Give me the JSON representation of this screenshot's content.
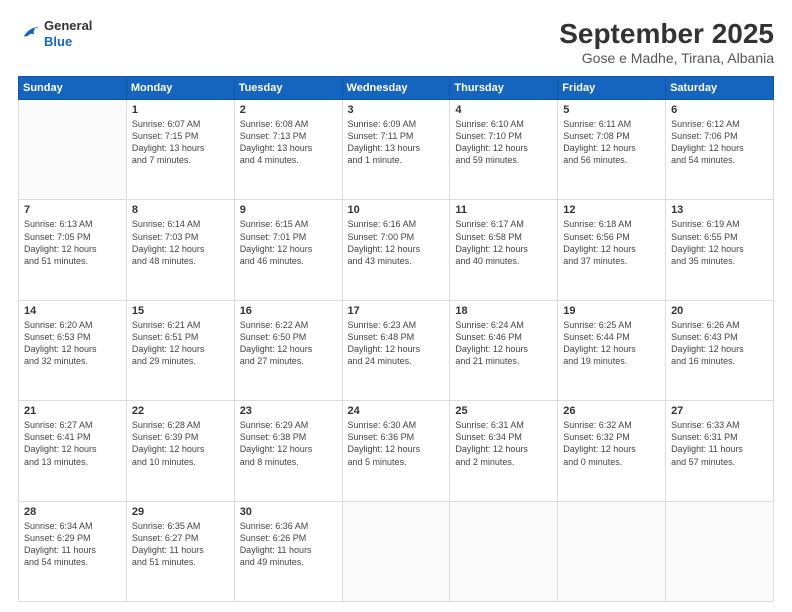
{
  "header": {
    "logo_general": "General",
    "logo_blue": "Blue",
    "title": "September 2025",
    "subtitle": "Gose e Madhe, Tirana, Albania"
  },
  "calendar": {
    "days_of_week": [
      "Sunday",
      "Monday",
      "Tuesday",
      "Wednesday",
      "Thursday",
      "Friday",
      "Saturday"
    ],
    "weeks": [
      [
        {
          "day": "",
          "info": ""
        },
        {
          "day": "1",
          "info": "Sunrise: 6:07 AM\nSunset: 7:15 PM\nDaylight: 13 hours\nand 7 minutes."
        },
        {
          "day": "2",
          "info": "Sunrise: 6:08 AM\nSunset: 7:13 PM\nDaylight: 13 hours\nand 4 minutes."
        },
        {
          "day": "3",
          "info": "Sunrise: 6:09 AM\nSunset: 7:11 PM\nDaylight: 13 hours\nand 1 minute."
        },
        {
          "day": "4",
          "info": "Sunrise: 6:10 AM\nSunset: 7:10 PM\nDaylight: 12 hours\nand 59 minutes."
        },
        {
          "day": "5",
          "info": "Sunrise: 6:11 AM\nSunset: 7:08 PM\nDaylight: 12 hours\nand 56 minutes."
        },
        {
          "day": "6",
          "info": "Sunrise: 6:12 AM\nSunset: 7:06 PM\nDaylight: 12 hours\nand 54 minutes."
        }
      ],
      [
        {
          "day": "7",
          "info": "Sunrise: 6:13 AM\nSunset: 7:05 PM\nDaylight: 12 hours\nand 51 minutes."
        },
        {
          "day": "8",
          "info": "Sunrise: 6:14 AM\nSunset: 7:03 PM\nDaylight: 12 hours\nand 48 minutes."
        },
        {
          "day": "9",
          "info": "Sunrise: 6:15 AM\nSunset: 7:01 PM\nDaylight: 12 hours\nand 46 minutes."
        },
        {
          "day": "10",
          "info": "Sunrise: 6:16 AM\nSunset: 7:00 PM\nDaylight: 12 hours\nand 43 minutes."
        },
        {
          "day": "11",
          "info": "Sunrise: 6:17 AM\nSunset: 6:58 PM\nDaylight: 12 hours\nand 40 minutes."
        },
        {
          "day": "12",
          "info": "Sunrise: 6:18 AM\nSunset: 6:56 PM\nDaylight: 12 hours\nand 37 minutes."
        },
        {
          "day": "13",
          "info": "Sunrise: 6:19 AM\nSunset: 6:55 PM\nDaylight: 12 hours\nand 35 minutes."
        }
      ],
      [
        {
          "day": "14",
          "info": "Sunrise: 6:20 AM\nSunset: 6:53 PM\nDaylight: 12 hours\nand 32 minutes."
        },
        {
          "day": "15",
          "info": "Sunrise: 6:21 AM\nSunset: 6:51 PM\nDaylight: 12 hours\nand 29 minutes."
        },
        {
          "day": "16",
          "info": "Sunrise: 6:22 AM\nSunset: 6:50 PM\nDaylight: 12 hours\nand 27 minutes."
        },
        {
          "day": "17",
          "info": "Sunrise: 6:23 AM\nSunset: 6:48 PM\nDaylight: 12 hours\nand 24 minutes."
        },
        {
          "day": "18",
          "info": "Sunrise: 6:24 AM\nSunset: 6:46 PM\nDaylight: 12 hours\nand 21 minutes."
        },
        {
          "day": "19",
          "info": "Sunrise: 6:25 AM\nSunset: 6:44 PM\nDaylight: 12 hours\nand 19 minutes."
        },
        {
          "day": "20",
          "info": "Sunrise: 6:26 AM\nSunset: 6:43 PM\nDaylight: 12 hours\nand 16 minutes."
        }
      ],
      [
        {
          "day": "21",
          "info": "Sunrise: 6:27 AM\nSunset: 6:41 PM\nDaylight: 12 hours\nand 13 minutes."
        },
        {
          "day": "22",
          "info": "Sunrise: 6:28 AM\nSunset: 6:39 PM\nDaylight: 12 hours\nand 10 minutes."
        },
        {
          "day": "23",
          "info": "Sunrise: 6:29 AM\nSunset: 6:38 PM\nDaylight: 12 hours\nand 8 minutes."
        },
        {
          "day": "24",
          "info": "Sunrise: 6:30 AM\nSunset: 6:36 PM\nDaylight: 12 hours\nand 5 minutes."
        },
        {
          "day": "25",
          "info": "Sunrise: 6:31 AM\nSunset: 6:34 PM\nDaylight: 12 hours\nand 2 minutes."
        },
        {
          "day": "26",
          "info": "Sunrise: 6:32 AM\nSunset: 6:32 PM\nDaylight: 12 hours\nand 0 minutes."
        },
        {
          "day": "27",
          "info": "Sunrise: 6:33 AM\nSunset: 6:31 PM\nDaylight: 11 hours\nand 57 minutes."
        }
      ],
      [
        {
          "day": "28",
          "info": "Sunrise: 6:34 AM\nSunset: 6:29 PM\nDaylight: 11 hours\nand 54 minutes."
        },
        {
          "day": "29",
          "info": "Sunrise: 6:35 AM\nSunset: 6:27 PM\nDaylight: 11 hours\nand 51 minutes."
        },
        {
          "day": "30",
          "info": "Sunrise: 6:36 AM\nSunset: 6:26 PM\nDaylight: 11 hours\nand 49 minutes."
        },
        {
          "day": "",
          "info": ""
        },
        {
          "day": "",
          "info": ""
        },
        {
          "day": "",
          "info": ""
        },
        {
          "day": "",
          "info": ""
        }
      ]
    ]
  }
}
